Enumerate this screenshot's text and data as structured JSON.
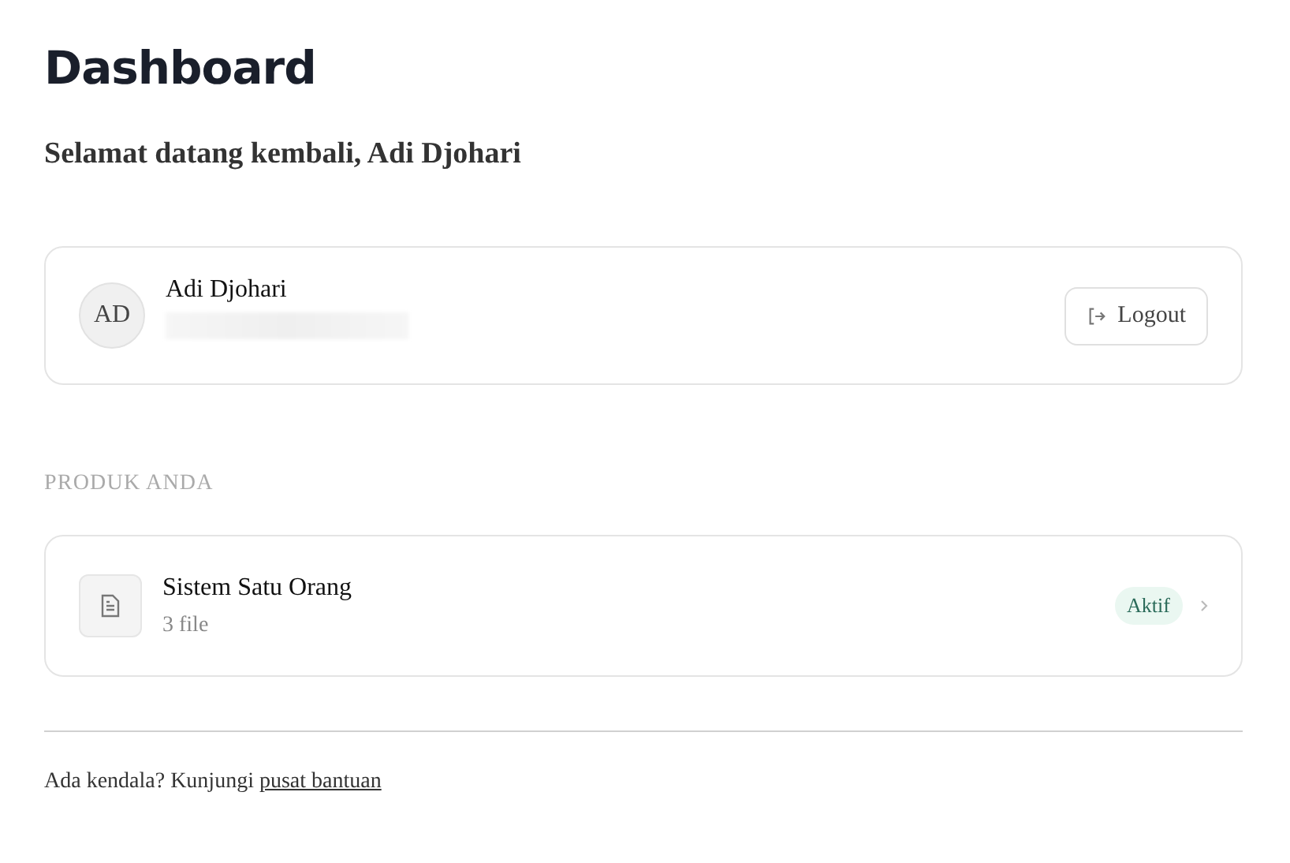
{
  "page": {
    "title": "Dashboard",
    "greeting": "Selamat datang kembali, Adi Djohari"
  },
  "profile": {
    "initials": "AD",
    "name": "Adi Djohari",
    "logout_label": "Logout"
  },
  "products_heading": "PRODUK ANDA",
  "products": [
    {
      "name": "Sistem Satu Orang",
      "files": "3 file",
      "status": "Aktif",
      "active": true
    }
  ],
  "footer": {
    "text": "Ada kendala? Kunjungi",
    "link": "pusat bantuan"
  }
}
